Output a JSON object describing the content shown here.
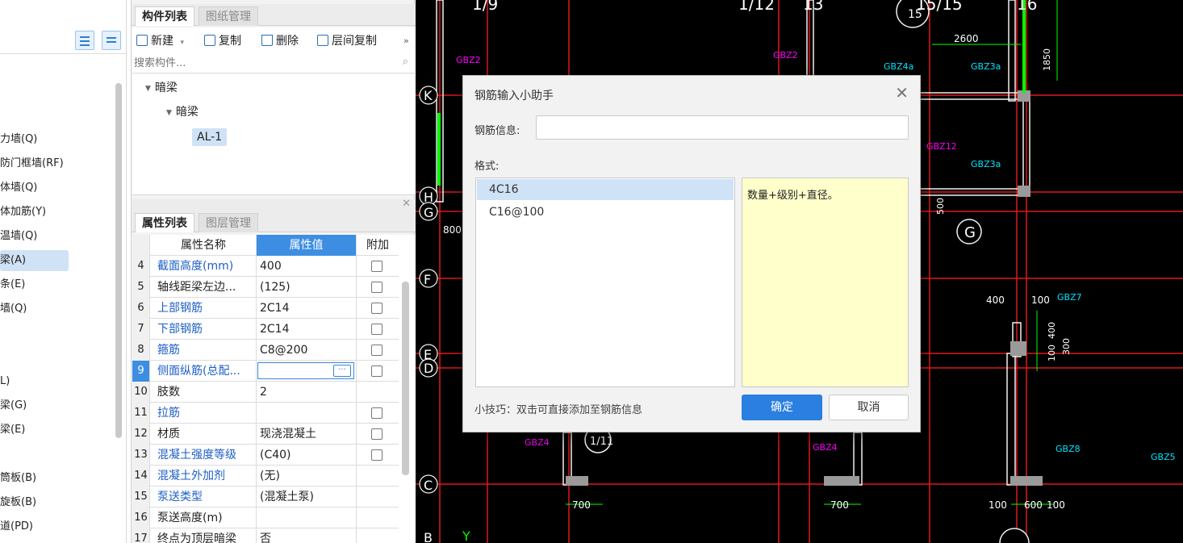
{
  "nav": {
    "items": [
      "力墙(Q)",
      "防门框墙(RF)",
      "体墙(Q)",
      "体加筋(Y)",
      "温墙(Q)",
      "梁(A)",
      "条(E)",
      "墙(Q)",
      "L)",
      "梁(G)",
      "梁(E)",
      "筒板(B)",
      "旋板(B)",
      "道(PD)"
    ],
    "selected_index": 5
  },
  "component_panel": {
    "tabs": [
      "构件列表",
      "图纸管理"
    ],
    "toolbar": {
      "new": "新建",
      "copy": "复制",
      "delete": "删除",
      "floor_copy": "层间复制",
      "more": "»"
    },
    "search_placeholder": "搜索构件...",
    "tree": {
      "root": "暗梁",
      "child": "暗梁",
      "leaf": "AL-1"
    }
  },
  "property_panel": {
    "tabs": [
      "属性列表",
      "图层管理"
    ],
    "columns": [
      "属性名称",
      "属性值",
      "附加"
    ],
    "rows": [
      {
        "num": "4",
        "name": "截面高度(mm)",
        "value": "400",
        "blue": true,
        "check": true
      },
      {
        "num": "5",
        "name": "轴线距梁左边...",
        "value": "(125)",
        "blue": false,
        "check": true
      },
      {
        "num": "6",
        "name": "上部钢筋",
        "value": "2C14",
        "blue": true,
        "check": true
      },
      {
        "num": "7",
        "name": "下部钢筋",
        "value": "2C14",
        "blue": true,
        "check": true
      },
      {
        "num": "8",
        "name": "箍筋",
        "value": "C8@200",
        "blue": true,
        "check": true
      },
      {
        "num": "9",
        "name": "侧面纵筋(总配...",
        "value": "",
        "blue": true,
        "check": true,
        "editing": true
      },
      {
        "num": "10",
        "name": "肢数",
        "value": "2",
        "blue": false,
        "check": false
      },
      {
        "num": "11",
        "name": "拉筋",
        "value": "",
        "blue": true,
        "check": true
      },
      {
        "num": "12",
        "name": "材质",
        "value": "现浇混凝土",
        "blue": false,
        "check": true
      },
      {
        "num": "13",
        "name": "混凝土强度等级",
        "value": "(C40)",
        "blue": true,
        "check": true
      },
      {
        "num": "14",
        "name": "混凝土外加剂",
        "value": "(无)",
        "blue": true,
        "check": false
      },
      {
        "num": "15",
        "name": "泵送类型",
        "value": "(混凝土泵)",
        "blue": true,
        "check": false
      },
      {
        "num": "16",
        "name": "泵送高度(m)",
        "value": "",
        "blue": false,
        "check": false
      },
      {
        "num": "17",
        "name": "终点为顶层暗梁",
        "value": "否",
        "blue": false,
        "check": false
      }
    ],
    "edit_button": "···"
  },
  "dialog": {
    "title": "钢筋输入小助手",
    "close": "✕",
    "info_label": "钢筋信息:",
    "info_value": "",
    "format_label": "格式:",
    "formats": [
      "4C16",
      "C16@100"
    ],
    "selected_format": 0,
    "description": "数量+级别+直径。",
    "tip": "小技巧：双击可直接添加至钢筋信息",
    "ok": "确定",
    "cancel": "取消"
  },
  "cad": {
    "top_labels": [
      "1/9",
      "1/12",
      "13",
      "15",
      "15/15",
      "16"
    ],
    "axis_letters": [
      "K",
      "H",
      "G",
      "F",
      "E",
      "D",
      "C",
      "B"
    ],
    "right_axis_letter": "G",
    "column_labels": [
      "GBZ2",
      "GBZ2",
      "GBZ4a",
      "GBZ3a",
      "GBZ12",
      "GBZ3a",
      "GBZ7",
      "GBZ4",
      "GBZ4",
      "GBZ8",
      "GBZ5"
    ],
    "dimensions": [
      "2600",
      "1850",
      "500",
      "800",
      "400",
      "100",
      "400",
      "300",
      "100",
      "700",
      "700",
      "100",
      "600",
      "100",
      "1/11",
      "Y"
    ],
    "colors": {
      "background": "#000000",
      "axis_red": "#e0191b",
      "wall_white": "#f0f0f0",
      "text_white": "#ffffff",
      "label_magenta": "#ff00ff",
      "label_cyan": "#00e5ff",
      "green": "#00ff00",
      "yellow": "#ffff7a"
    }
  }
}
